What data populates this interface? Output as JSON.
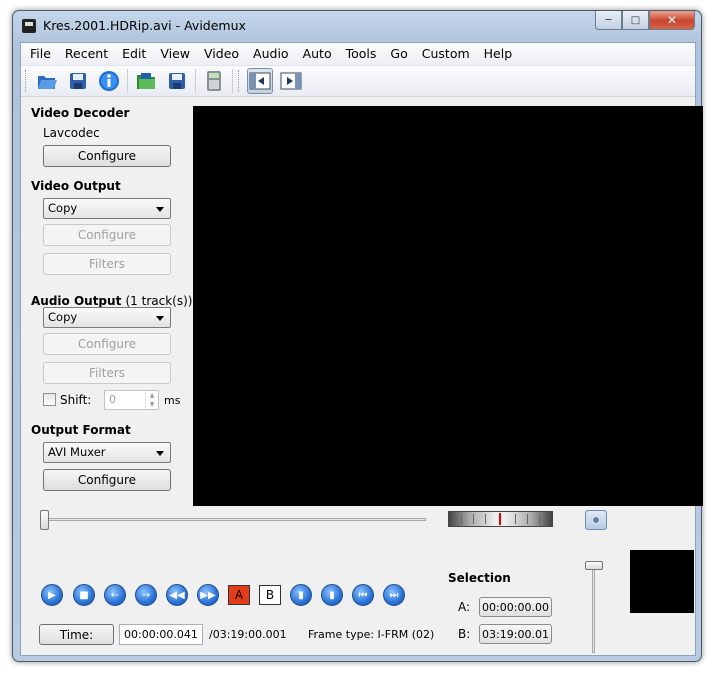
{
  "window": {
    "title": "Kres.2001.HDRip.avi - Avidemux"
  },
  "menu": [
    "File",
    "Recent",
    "Edit",
    "View",
    "Video",
    "Audio",
    "Auto",
    "Tools",
    "Go",
    "Custom",
    "Help"
  ],
  "toolbar_icons": [
    "open-icon",
    "save-icon",
    "info-icon",
    "open-folder-icon",
    "save-disk-icon",
    "calculator-icon",
    "toggle-left-panel-icon",
    "toggle-right-panel-icon"
  ],
  "video_decoder": {
    "heading": "Video Decoder",
    "codec": "Lavcodec",
    "configure": "Configure"
  },
  "video_output": {
    "heading": "Video Output",
    "selected": "Copy",
    "configure": "Configure",
    "filters": "Filters"
  },
  "audio_output": {
    "heading": "Audio Output",
    "tracks": "(1 track(s))",
    "selected": "Copy",
    "configure": "Configure",
    "filters": "Filters",
    "shift_label": "Shift:",
    "shift_value": "0",
    "shift_unit": "ms"
  },
  "output_format": {
    "heading": "Output Format",
    "selected": "AVI Muxer",
    "configure": "Configure"
  },
  "marker_a": "A",
  "marker_b": "B",
  "selection": {
    "title": "Selection",
    "a_label": "A:",
    "a_value": "00:00:00.00",
    "b_label": "B:",
    "b_value": "03:19:00.01"
  },
  "status": {
    "time_button": "Time:",
    "current_time": "00:00:00.041",
    "total_time": "/03:19:00.001",
    "frame_type": "Frame type:  I-FRM (02)"
  }
}
